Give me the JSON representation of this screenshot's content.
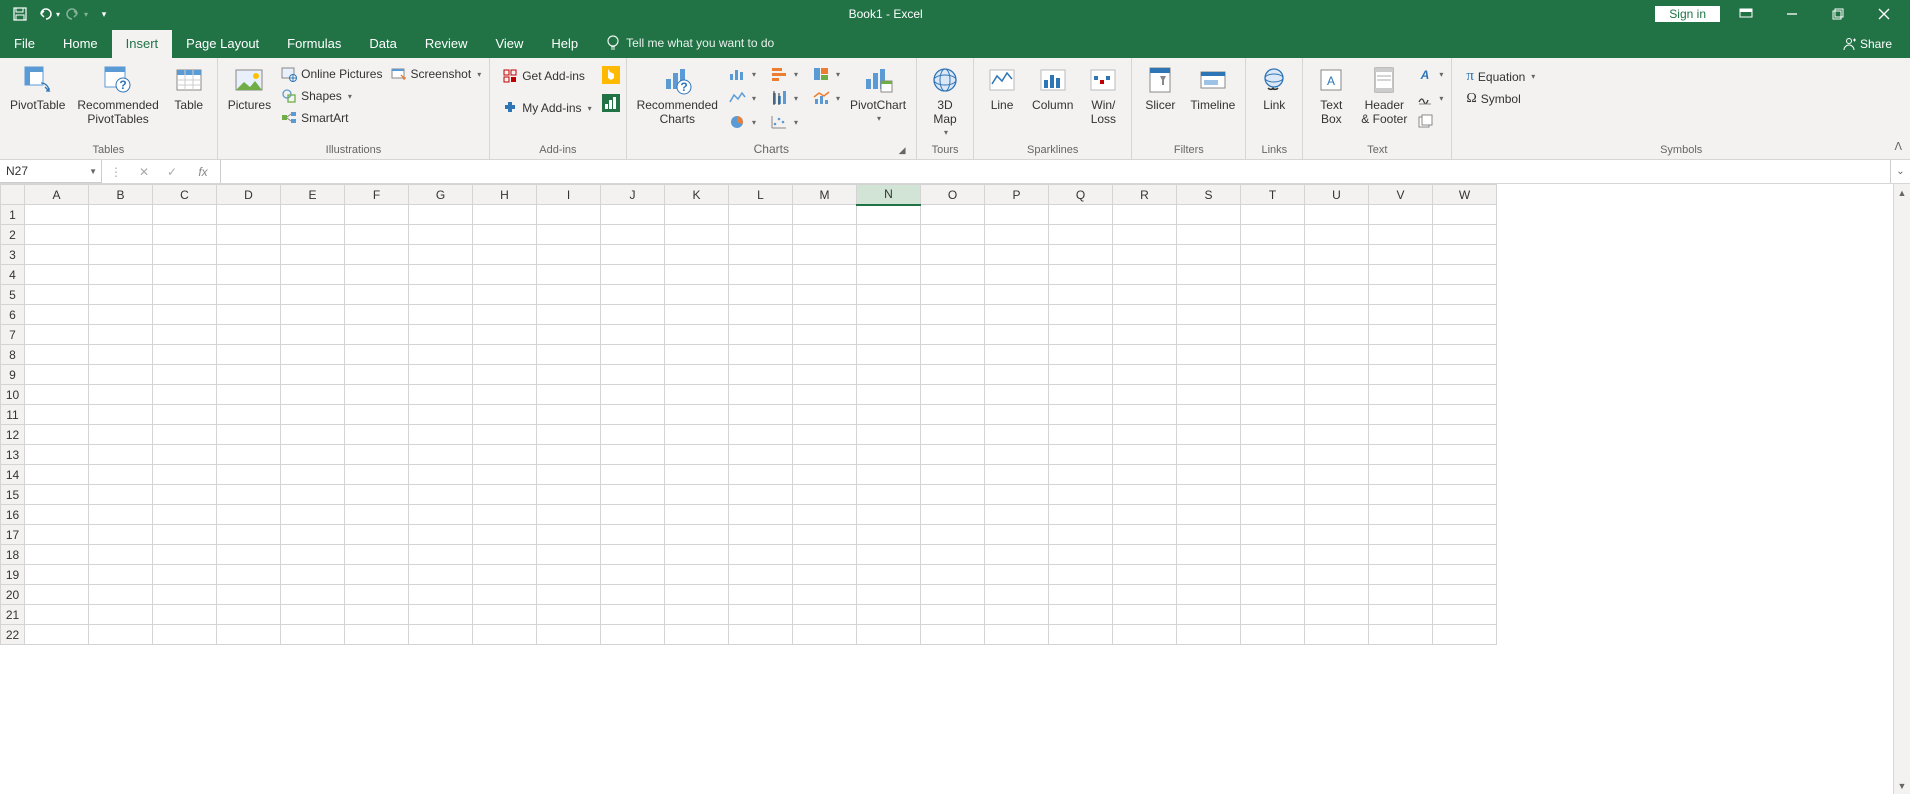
{
  "title": "Book1  -  Excel",
  "signin": "Sign in",
  "tabs": {
    "file": "File",
    "home": "Home",
    "insert": "Insert",
    "page_layout": "Page Layout",
    "formulas": "Formulas",
    "data": "Data",
    "review": "Review",
    "view": "View",
    "help": "Help",
    "tellme": "Tell me what you want to do",
    "share": "Share"
  },
  "ribbon": {
    "tables": {
      "label": "Tables",
      "pivottable": "PivotTable",
      "recommended": "Recommended\nPivotTables",
      "table": "Table"
    },
    "illustrations": {
      "label": "Illustrations",
      "pictures": "Pictures",
      "online_pictures": "Online Pictures",
      "shapes": "Shapes",
      "smartart": "SmartArt",
      "screenshot": "Screenshot"
    },
    "addins": {
      "label": "Add-ins",
      "get": "Get Add-ins",
      "my": "My Add-ins"
    },
    "charts": {
      "label": "Charts",
      "recommended": "Recommended\nCharts",
      "pivotchart": "PivotChart"
    },
    "tours": {
      "label": "Tours",
      "map": "3D\nMap"
    },
    "sparklines": {
      "label": "Sparklines",
      "line": "Line",
      "column": "Column",
      "winloss": "Win/\nLoss"
    },
    "filters": {
      "label": "Filters",
      "slicer": "Slicer",
      "timeline": "Timeline"
    },
    "links": {
      "label": "Links",
      "link": "Link"
    },
    "text": {
      "label": "Text",
      "textbox": "Text\nBox",
      "header": "Header\n& Footer"
    },
    "symbols": {
      "label": "Symbols",
      "equation": "Equation",
      "symbol": "Symbol"
    }
  },
  "namebox": "N27",
  "columns": [
    "A",
    "B",
    "C",
    "D",
    "E",
    "F",
    "G",
    "H",
    "I",
    "J",
    "K",
    "L",
    "M",
    "N",
    "O",
    "P",
    "Q",
    "R",
    "S",
    "T",
    "U",
    "V",
    "W"
  ],
  "rows": [
    "1",
    "2",
    "3",
    "4",
    "5",
    "6",
    "7",
    "8",
    "9",
    "10",
    "11",
    "12",
    "13",
    "14",
    "15",
    "16",
    "17",
    "18",
    "19",
    "20",
    "21",
    "22"
  ],
  "selected_col": "N"
}
